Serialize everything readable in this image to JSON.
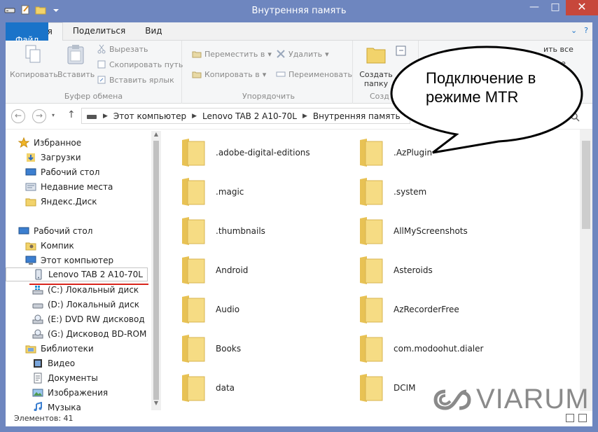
{
  "window": {
    "title": "Внутренняя память"
  },
  "window_controls": {
    "minimize": "—",
    "maximize": "□",
    "close": "✕"
  },
  "tabs": [
    {
      "label": "Файл"
    },
    {
      "label": "Главная"
    },
    {
      "label": "Поделиться"
    },
    {
      "label": "Вид"
    }
  ],
  "ribbon": {
    "clipboard": {
      "label": "Буфер обмена",
      "copy": "Копировать",
      "paste": "Вставить",
      "cut": "Вырезать",
      "copy_path": "Скопировать путь",
      "paste_shortcut": "Вставить ярлык"
    },
    "organize": {
      "label": "Упорядочить",
      "move_to": "Переместить в",
      "copy_to": "Копировать в",
      "delete": "Удалить",
      "rename": "Переименовать"
    },
    "new": {
      "label": "Созд",
      "new_folder_line1": "Создать",
      "new_folder_line2": "папку"
    },
    "select": {
      "all_partial": "ить все",
      "none_partial": "ие"
    }
  },
  "address": {
    "parts": [
      "Этот компьютер",
      "Lenovo TAB 2 A10-70L",
      "Внутренняя память"
    ]
  },
  "nav": {
    "favorites": "Избранное",
    "downloads": "Загрузки",
    "desktop_fav": "Рабочий стол",
    "recent": "Недавние места",
    "yandex": "Яндекс.Диск",
    "desktop": "Рабочий стол",
    "user": "Компик",
    "this_pc": "Этот компьютер",
    "lenovo": "Lenovo TAB 2 A10-70L",
    "drive_c": "(C:) Локальный диск",
    "drive_d": "(D:) Локальный диск",
    "drive_e": "(E:) DVD RW дисковод",
    "drive_g": "(G:) Дисковод BD-ROM",
    "libraries": "Библиотеки",
    "video": "Видео",
    "documents": "Документы",
    "images": "Изображения",
    "music": "Музыка"
  },
  "files": [
    ".adobe-digital-editions",
    ".AzPlugin",
    ".magic",
    ".system",
    ".thumbnails",
    "AllMyScreenshots",
    "Android",
    "Asteroids",
    "Audio",
    "AzRecorderFree",
    "Books",
    "com.modoohut.dialer",
    "data",
    "DCIM"
  ],
  "status": {
    "items": "Элементов: 41"
  },
  "callout": {
    "text": "Подключение в режиме MTR"
  },
  "watermark": {
    "text": "VIARUM"
  },
  "colors": {
    "titlebar": "#6e86bf",
    "file_tab": "#1a73c9",
    "underline": "#d9251c",
    "folder": "#f2d36b"
  }
}
